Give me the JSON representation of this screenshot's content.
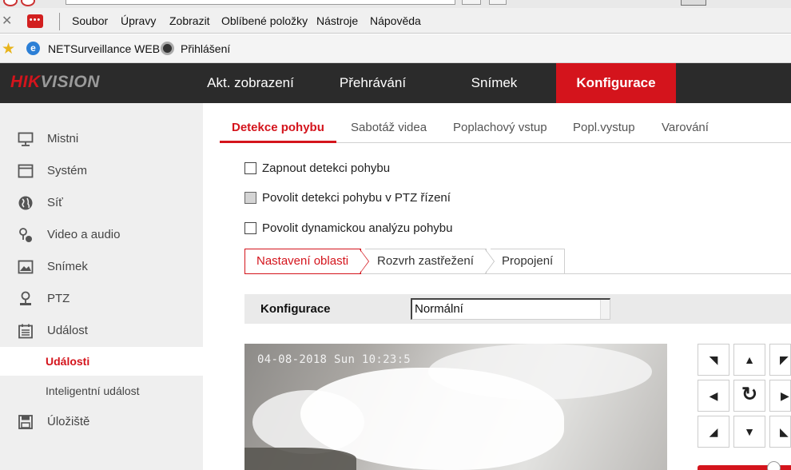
{
  "browser": {
    "menu": [
      "Soubor",
      "Úpravy",
      "Zobrazit",
      "Oblíbené položky",
      "Nástroje",
      "Nápověda"
    ],
    "favorites": [
      "NETSurveillance WEB",
      "Přihlášení"
    ]
  },
  "header": {
    "logo_red": "HIK",
    "logo_gray": "VISION",
    "nav": [
      "Akt. zobrazení",
      "Přehrávání",
      "Snímek",
      "Konfigurace"
    ],
    "active_nav": "Konfigurace"
  },
  "sidebar": {
    "items": [
      {
        "label": "Mistni",
        "icon": "monitor-icon"
      },
      {
        "label": "Systém",
        "icon": "window-icon"
      },
      {
        "label": "Síť",
        "icon": "globe-icon"
      },
      {
        "label": "Video a audio",
        "icon": "mic-camera-icon"
      },
      {
        "label": "Snímek",
        "icon": "image-icon"
      },
      {
        "label": "PTZ",
        "icon": "ptz-camera-icon"
      },
      {
        "label": "Událost",
        "icon": "calendar-icon"
      },
      {
        "label": "Úložiště",
        "icon": "floppy-icon"
      }
    ],
    "subitems": [
      "Události",
      "Inteligentní událost"
    ],
    "active_subitem": "Události"
  },
  "tabs": [
    "Detekce pohybu",
    "Sabotáž videa",
    "Poplachový vstup",
    "Popl.vystup",
    "Varování"
  ],
  "active_tab": "Detekce pohybu",
  "checkboxes": [
    {
      "label": "Zapnout detekci pohybu",
      "checked": false,
      "disabled": false
    },
    {
      "label": "Povolit detekci pohybu v PTZ řízení",
      "checked": false,
      "disabled": true
    },
    {
      "label": "Povolit dynamickou analýzu pohybu",
      "checked": false,
      "disabled": false
    }
  ],
  "subtabs": [
    "Nastavení oblasti",
    "Rozvrh zastřežení",
    "Propojení"
  ],
  "active_subtab": "Nastavení oblasti",
  "config": {
    "label": "Konfigurace",
    "value": "Normální"
  },
  "video": {
    "timestamp": "04-08-2018 Sun 10:23:5"
  },
  "ptz": {
    "buttons": [
      "up-left",
      "up",
      "up-right",
      "left",
      "auto",
      "right",
      "down-left",
      "down",
      "down-right"
    ]
  },
  "colors": {
    "accent": "#d4141c",
    "header_bg": "#2b2b2b",
    "sidebar_bg": "#efefef"
  }
}
